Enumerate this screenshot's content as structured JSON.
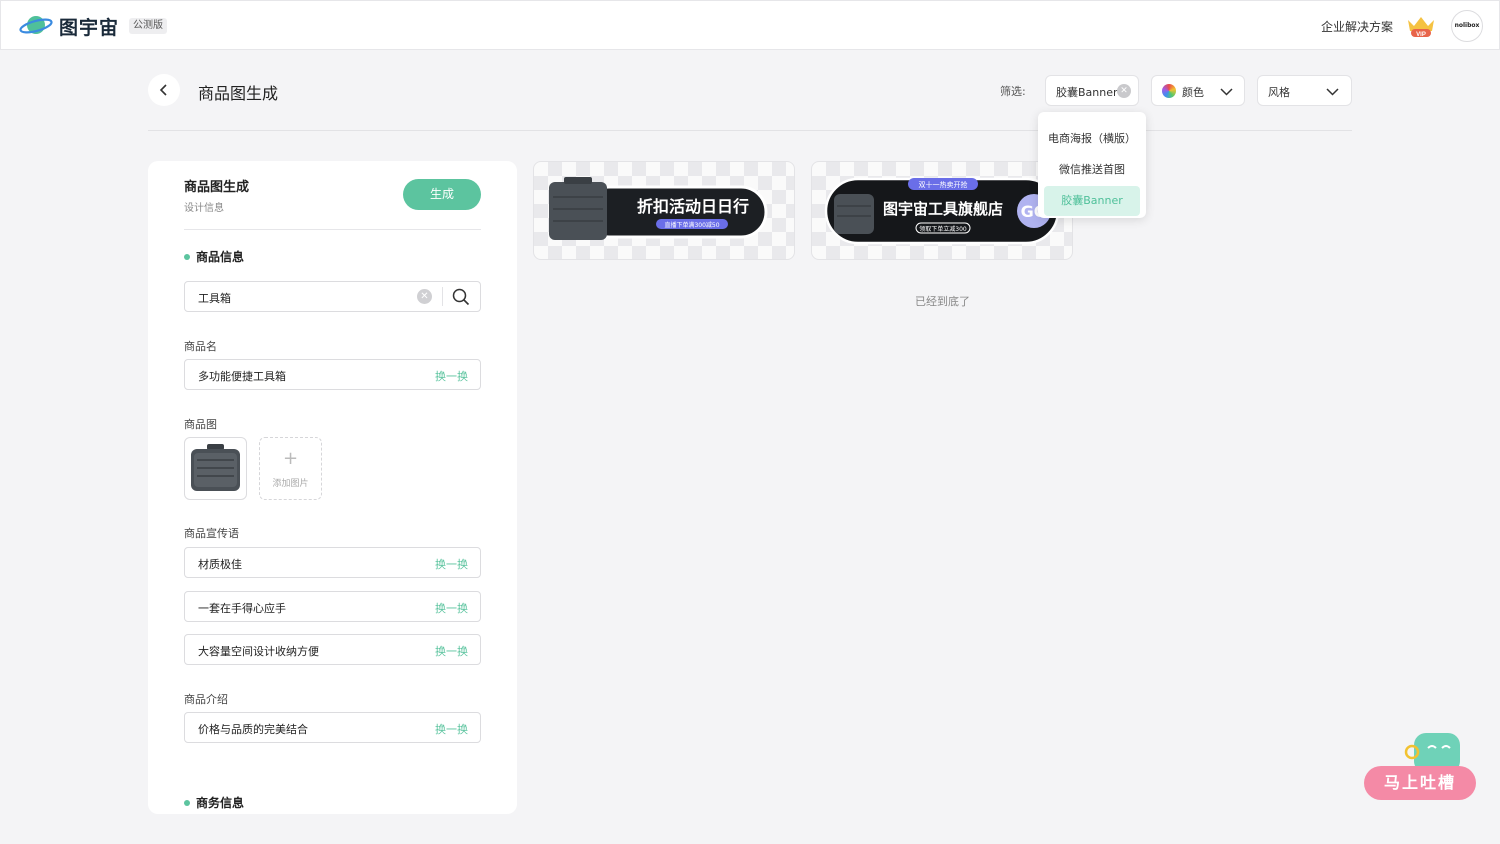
{
  "app": {
    "brand": "图宇宙",
    "badge": "公测版"
  },
  "topbar": {
    "enterprise": "企业解决方案",
    "vip_label": "VIP",
    "avatar_text": "nolibox"
  },
  "header": {
    "title": "商品图生成",
    "filter_label": "筛选:"
  },
  "filters": {
    "type": {
      "value": "胶囊Banner"
    },
    "color": {
      "label": "颜色"
    },
    "style": {
      "label": "风格"
    }
  },
  "dropdown": {
    "items": [
      {
        "label": "电商海报（横版）"
      },
      {
        "label": "微信推送首图"
      },
      {
        "label": "胶囊Banner",
        "selected": true
      }
    ]
  },
  "panel": {
    "title": "商品图生成",
    "subtitle": "设计信息",
    "generate_button": "生成",
    "product_info": {
      "heading": "商品信息",
      "search_value": "工具箱",
      "name_label": "商品名",
      "name_value": "多功能便捷工具箱",
      "image_label": "商品图",
      "add_image": "添加图片",
      "slogan_label": "商品宣传语",
      "slogans": [
        "材质极佳",
        "一套在手得心应手",
        "大容量空间设计收纳方便"
      ],
      "intro_label": "商品介绍",
      "intro_value": "价格与品质的完美结合"
    },
    "business_info": {
      "heading": "商务信息"
    },
    "swap_label": "换一换"
  },
  "results": {
    "cards": [
      {
        "headline": "折扣活动日日行",
        "subline": "直播下单满300减50"
      },
      {
        "tag": "双十一热卖开抢",
        "headline": "图宇宙工具旗舰店",
        "subline": "领取下单立减300",
        "button": "GO"
      }
    ],
    "end_text": "已经到底了"
  },
  "feedback": {
    "label": "马上吐槽"
  },
  "colors": {
    "accent": "#5cc49f",
    "feedback": "#f48aa6"
  }
}
